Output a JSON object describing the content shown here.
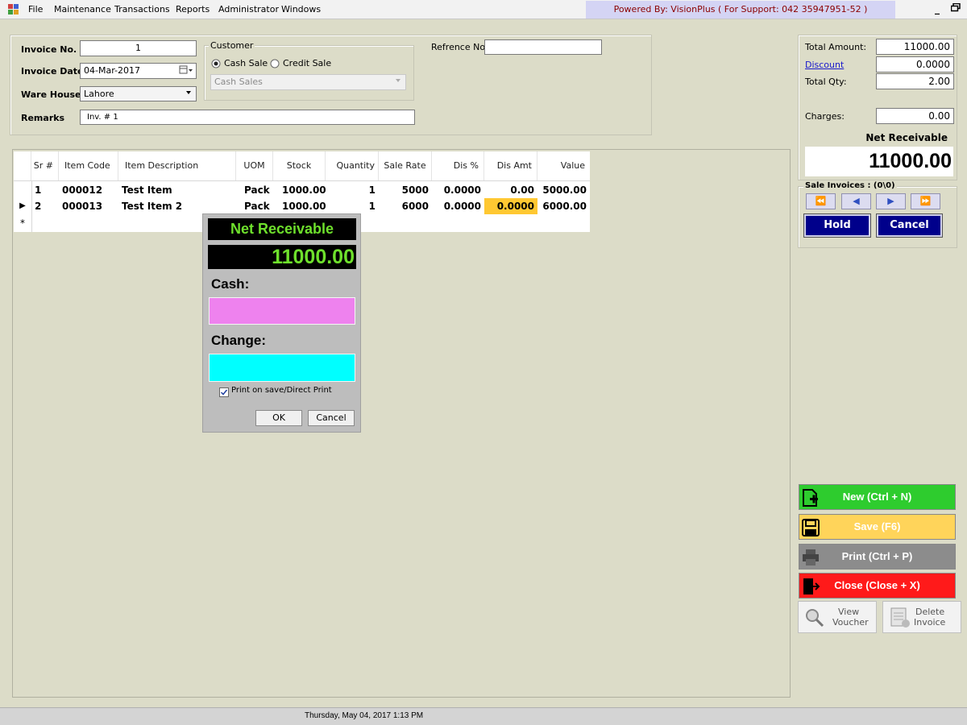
{
  "menu": {
    "items": [
      "File",
      "Maintenance",
      "Transactions",
      "Reports",
      "Administrator",
      "Windows"
    ],
    "powered_by": "Powered By: VisionPlus ( For Support: 042 35947951-52 )",
    "minimize": "_",
    "restore": "\u0002"
  },
  "header": {
    "invoice_no_label": "Invoice No.",
    "invoice_no": "1",
    "invoice_date_label": "Invoice Date",
    "invoice_date": "04-Mar-2017",
    "warehouse_label": "Ware House",
    "warehouse": "Lahore",
    "remarks_label": "Remarks",
    "remarks": "Inv. # 1",
    "customer_label": "Customer",
    "cash_sale_label": "Cash Sale",
    "credit_sale_label": "Credit Sale",
    "customer_value": "Cash Sales",
    "reference_label": "Refrence No",
    "reference_value": ""
  },
  "grid": {
    "columns": [
      "Sr #",
      "Item Code",
      "Item Description",
      "UOM",
      "Stock",
      "Quantity",
      "Sale Rate",
      "Dis %",
      "Dis Amt",
      "Value"
    ],
    "rows": [
      {
        "sr": "1",
        "code": "000012",
        "desc": "Test Item",
        "uom": "Pack",
        "stock": "1000.00",
        "qty": "1",
        "rate": "5000",
        "dis_pct": "0.0000",
        "dis_amt": "0.00",
        "value": "5000.00"
      },
      {
        "sr": "2",
        "code": "000013",
        "desc": "Test Item 2",
        "uom": "Pack",
        "stock": "1000.00",
        "qty": "1",
        "rate": "6000",
        "dis_pct": "0.0000",
        "dis_amt": "0.0000",
        "value": "6000.00"
      }
    ],
    "current_row_marker": "▶",
    "new_row_marker": "*"
  },
  "dialog": {
    "title": "Net Receivable",
    "amount": "11000.00",
    "cash_label": "Cash:",
    "cash_value": "",
    "change_label": "Change:",
    "change_value": "",
    "print_label": "Print on save/Direct Print",
    "print_checked": true,
    "ok_label": "OK",
    "cancel_label": "Cancel"
  },
  "totals": {
    "total_amount_label": "Total Amount:",
    "total_amount": "11000.00",
    "discount_label": "Discount",
    "discount": "0.0000",
    "total_qty_label": "Total Qty:",
    "total_qty": "2.00",
    "charges_label": "Charges:",
    "charges": "0.00",
    "net_receivable_label": "Net Receivable",
    "net_receivable": "11000.00"
  },
  "sale_invoices": {
    "label": "Sale Invoices : (0\\0)",
    "nav": [
      "⏪",
      "◀",
      "▶",
      "⏩"
    ],
    "hold_label": "Hold",
    "cancel_label": "Cancel"
  },
  "actions": {
    "new_label": "New (Ctrl + N)",
    "save_label": "Save (F6)",
    "print_label": "Print (Ctrl + P)",
    "close_label": "Close (Close + X)",
    "view_voucher_label_1": "View",
    "view_voucher_label_2": "Voucher",
    "delete_invoice_label_1": "Delete",
    "delete_invoice_label_2": "Invoice"
  },
  "colors": {
    "new": "#2ecc2e",
    "save": "#ffd45a",
    "print": "#8c8c8c",
    "close": "#ff1a1a",
    "selected_cell": "#ffc832"
  },
  "status": {
    "datetime": "Thursday, May 04, 2017 1:13 PM"
  }
}
